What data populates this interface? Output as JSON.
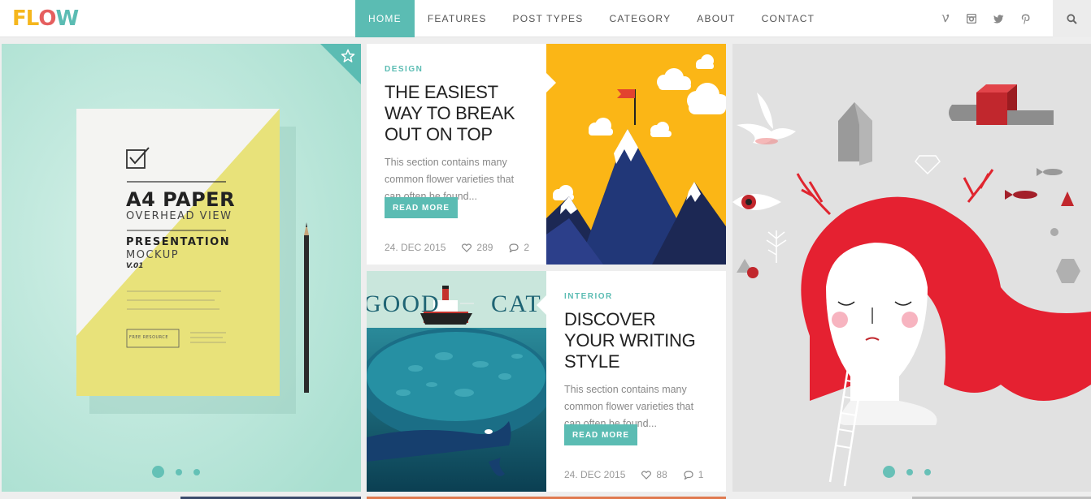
{
  "brand": {
    "logo_text": [
      "F",
      "L",
      "O",
      "W"
    ],
    "logo_colors": [
      "#f5b61d",
      "#f5b61d",
      "#e55f5f",
      "#5bbcb3"
    ],
    "accent": "#5bbcb3"
  },
  "nav": {
    "items": [
      "HOME",
      "FEATURES",
      "POST TYPES",
      "CATEGORY",
      "ABOUT",
      "CONTACT"
    ],
    "active": "HOME"
  },
  "social": {
    "icons": [
      "vimeo-icon",
      "instagram-icon",
      "twitter-icon",
      "pinterest-icon"
    ],
    "glyphs": [
      "V",
      "◫",
      "t",
      "P"
    ]
  },
  "search": {
    "icon": "search-icon"
  },
  "featured_left": {
    "mockup": {
      "title": "A4 PAPER",
      "subtitle": "OVERHEAD VIEW",
      "heading": "PRESENTATION",
      "heading2": "MOCKUP",
      "version": "V.01",
      "badge": "FREE RESOURCE"
    },
    "slider_dots": 3,
    "star_icon": "star-icon"
  },
  "posts": [
    {
      "category": "DESIGN",
      "title": "THE EASIEST WAY TO BREAK OUT ON TOP",
      "excerpt": "This section contains many common flower varieties that can often be found...",
      "button": "READ MORE",
      "date": "24. DEC 2015",
      "likes": "289",
      "comments": "2"
    },
    {
      "category": "INTERIOR",
      "title": "DISCOVER YOUR WRITING STYLE",
      "excerpt": "This section contains many common flower varieties that can often be found...",
      "button": "READ MORE",
      "date": "24. DEC 2015",
      "likes": "88",
      "comments": "1",
      "image_text_left": "GOOD",
      "image_text_right": "CATCH"
    }
  ],
  "featured_right": {
    "slider_dots": 3
  }
}
